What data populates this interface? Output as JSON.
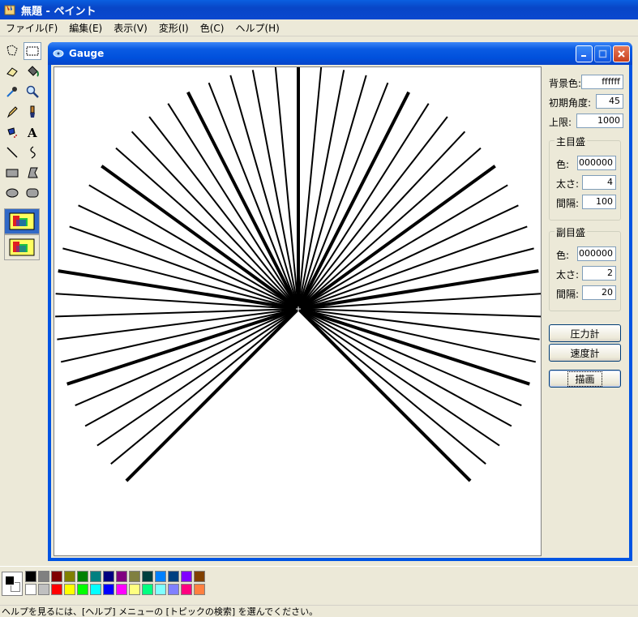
{
  "app": {
    "title": "無題 - ペイント",
    "menu": [
      "ファイル(F)",
      "編集(E)",
      "表示(V)",
      "変形(I)",
      "色(C)",
      "ヘルプ(H)"
    ]
  },
  "gauge_window": {
    "title": "Gauge",
    "settings": {
      "bg_label": "背景色:",
      "bg_value": "ffffff",
      "start_angle_label": "初期角度:",
      "start_angle_value": "45",
      "max_label": "上限:",
      "max_value": "1000"
    },
    "major_group": {
      "title": "主目盛",
      "color_label": "色:",
      "color_value": "000000",
      "width_label": "太さ:",
      "width_value": "4",
      "interval_label": "間隔:",
      "interval_value": "100"
    },
    "minor_group": {
      "title": "副目盛",
      "color_label": "色:",
      "color_value": "000000",
      "width_label": "太さ:",
      "width_value": "2",
      "interval_label": "間隔:",
      "interval_value": "20"
    },
    "buttons": {
      "pressure": "圧力計",
      "speed": "速度計",
      "draw": "描画"
    },
    "gauge_drawing": {
      "start_angle_deg": 45,
      "max": 1000,
      "major_interval": 100,
      "minor_interval": 20,
      "major_width": 4,
      "minor_width": 2,
      "color": "#000000",
      "background": "#ffffff"
    }
  },
  "palette": {
    "foreground": "#000000",
    "background": "#ffffff",
    "colors_top": [
      "#000000",
      "#808080",
      "#800000",
      "#808000",
      "#008000",
      "#008080",
      "#000080",
      "#800080",
      "#808040",
      "#004040",
      "#0080ff",
      "#004080",
      "#8000ff",
      "#804000"
    ],
    "colors_bottom": [
      "#ffffff",
      "#c0c0c0",
      "#ff0000",
      "#ffff00",
      "#00ff00",
      "#00ffff",
      "#0000ff",
      "#ff00ff",
      "#ffff80",
      "#00ff80",
      "#80ffff",
      "#8080ff",
      "#ff0080",
      "#ff8040"
    ]
  },
  "status": {
    "text": "ヘルプを見るには、[ヘルプ] メニューの [トピックの検索] を選んでください。"
  }
}
